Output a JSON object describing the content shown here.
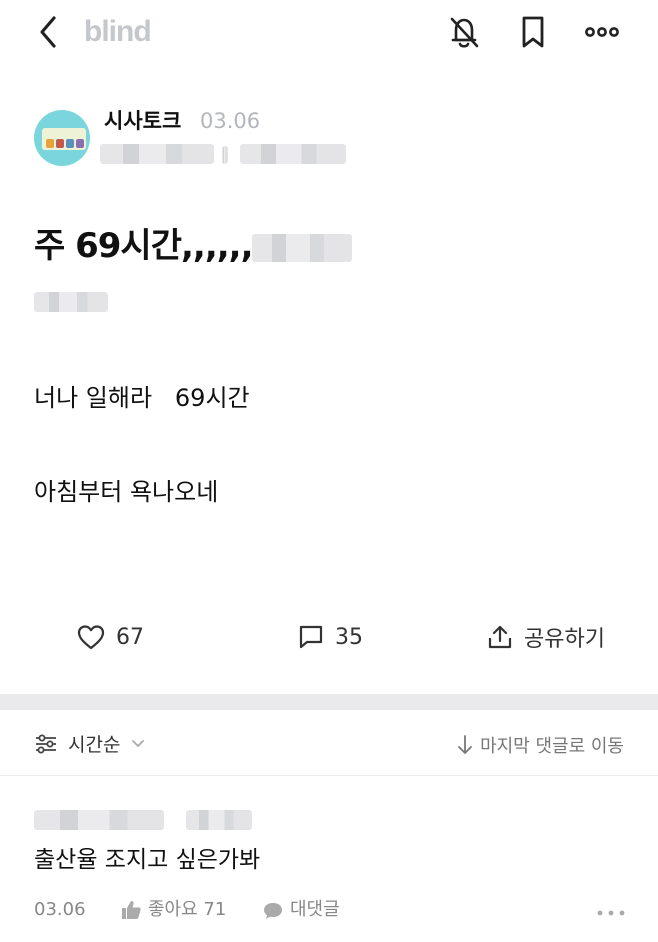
{
  "app": {
    "logo": "blind",
    "icons": [
      "back-arrow-icon",
      "bell-off-icon",
      "bookmark-icon",
      "more-icon"
    ]
  },
  "post": {
    "channel": "시사토크",
    "date": "03.06",
    "title": "주 69시간,,,,,,,",
    "body_lines": [
      "너나 일해라   69시간",
      "아침부터 욕나오네"
    ],
    "likes": "67",
    "comments": "35",
    "share_label": "공유하기"
  },
  "comment_bar": {
    "sort_label": "시간순",
    "jump_label": "마지막 댓글로 이동"
  },
  "comment": {
    "text": "출산율 조지고 싶은가봐",
    "date": "03.06",
    "like_label": "좋아요 71",
    "reply_label": "대댓글"
  },
  "colors": {
    "logo": "#c4c7cc",
    "avatar_bg": "#7ad6dc",
    "divider": "#eaeaec",
    "muted_text": "#888888"
  }
}
